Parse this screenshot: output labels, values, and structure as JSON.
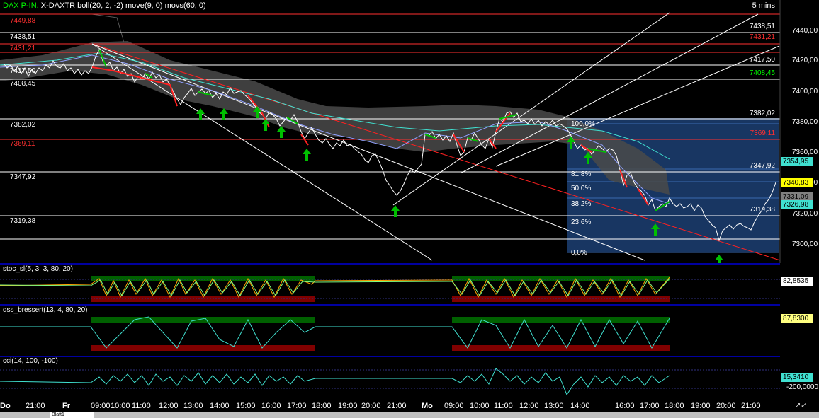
{
  "header": {
    "symbol_prefix": "DAX P-IN.",
    "symbol": "X-DAXTR",
    "indicators": "boll(20, 2, -2) move(9, 0) movs(60, 0)",
    "timeframe": "5 mins"
  },
  "price_axis": {
    "ticks": [
      "7440,00",
      "7420,00",
      "7400,00",
      "7380,00",
      "7360,00",
      "7340,00",
      "7320,00",
      "7300,00"
    ]
  },
  "levels_left": [
    {
      "label": "7449,88",
      "color": "#ff3030"
    },
    {
      "label": "7438,51",
      "color": "#ffffff"
    },
    {
      "label": "7431,21",
      "color": "#ff3030"
    },
    {
      "label": "7417,50",
      "color": "#ffffff"
    },
    {
      "label": "7408,45",
      "color": "#ffffff"
    },
    {
      "label": "7382,02",
      "color": "#ffffff"
    },
    {
      "label": "7369,11",
      "color": "#ff3030"
    },
    {
      "label": "7347,92",
      "color": "#ffffff"
    },
    {
      "label": "7319,38",
      "color": "#ffffff"
    }
  ],
  "levels_right": [
    {
      "label": "7438,51",
      "color": "#ffffff"
    },
    {
      "label": "7431,21",
      "color": "#ff3030"
    },
    {
      "label": "7417,50",
      "color": "#ffffff"
    },
    {
      "label": "7408,45",
      "color": "#00ff00"
    },
    {
      "label": "7382,02",
      "color": "#ffffff"
    },
    {
      "label": "7369,11",
      "color": "#ff3030"
    },
    {
      "label": "7347,92",
      "color": "#ffffff"
    },
    {
      "label": "7319,38",
      "color": "#ffffff"
    }
  ],
  "fib_labels": [
    "100,0%",
    "81,8%",
    "50,0%",
    "38,2%",
    "23,6%",
    "0,0%"
  ],
  "price_badges": {
    "upper": "7354,95",
    "last": "7340,83",
    "mid": "7331,09",
    "low": "7326,98"
  },
  "indicators": {
    "stoc": {
      "title": "stoc_sl(5, 3, 3, 80, 20)",
      "value": "82,8535"
    },
    "dss": {
      "title": "dss_bressert(13, 4, 80, 20)",
      "value": "87,8300"
    },
    "cci": {
      "title": "cci(14, 100, -100)",
      "value": "15,3410",
      "level": "-200,0000"
    }
  },
  "time_axis": [
    "Do",
    "21:00",
    "Fr",
    "09:00",
    "10:00",
    "11:00",
    "12:00",
    "13:00",
    "14:00",
    "15:00",
    "16:00",
    "17:00",
    "18:00",
    "19:00",
    "20:00",
    "21:00",
    "Mo",
    "09:00",
    "10:00",
    "11:00",
    "12:00",
    "13:00",
    "14:00",
    "16:00",
    "17:00",
    "18:00",
    "19:00",
    "20:00",
    "21:00"
  ],
  "sheet_tab": "Blatt1",
  "colors": {
    "up_arrow": "#00c000",
    "bands": "#505050",
    "ma_fast": "#40e0d0",
    "trend_red": "#ff2020",
    "fib_box": "#1a4a8a"
  }
}
